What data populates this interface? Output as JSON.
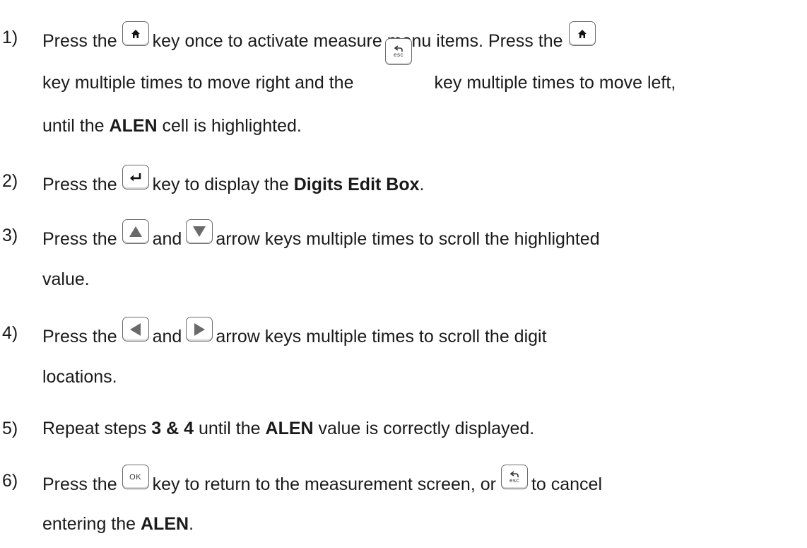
{
  "steps": [
    {
      "num": "1)",
      "lines": [
        {
          "a": "Press the",
          "b": "key once to activate meas",
          "c": "ure",
          "d": "menu items.  Press the"
        },
        {
          "a": "key multiple times to move right and the",
          "b": "key multiple times to move left,"
        },
        {
          "a": "until the",
          "bold": "ALEN",
          "b": "cell is highlighted."
        }
      ]
    },
    {
      "num": "2)",
      "a": "Press the",
      "b": "key to display the",
      "bold": "Digits Edit Box",
      "c": "."
    },
    {
      "num": "3)",
      "a": "Press the",
      "b": "and",
      "c": "arrow keys multiple times to scroll the highlighted",
      "d": "value."
    },
    {
      "num": "4)",
      "a": "Press the",
      "b": "and",
      "c": "arrow keys multiple times to scroll the digit",
      "d": "locations."
    },
    {
      "num": "5)",
      "a": "Repeat steps",
      "bold1": "3 & 4",
      "b": "until the",
      "bold2": "ALEN",
      "c": "value is correctly displayed."
    },
    {
      "num": "6)",
      "a": "Press the",
      "b": "key to return to the measurement screen, or",
      "c": "to cancel",
      "d": "entering the",
      "bold": "ALEN",
      "e": "."
    }
  ],
  "keys": {
    "ok_label": "OK",
    "esc_label": "esc",
    "home_icon": "home-icon",
    "enter_icon": "enter-icon",
    "up_icon": "up-arrow-icon",
    "down_icon": "down-arrow-icon",
    "left_icon": "left-arrow-icon",
    "right_icon": "right-arrow-icon",
    "back_icon": "back-arrow-icon"
  }
}
